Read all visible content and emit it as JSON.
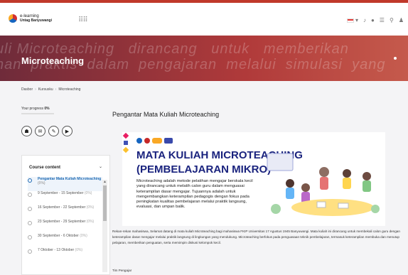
{
  "header": {
    "logo_line1": "e-learning",
    "logo_line2": "Untag Banyuwangi",
    "apps_icon": "grid-icon",
    "right_icons": [
      "flag-icon",
      "bell-icon",
      "chat-icon",
      "menu-icon",
      "search-icon",
      "user-icon"
    ]
  },
  "hero": {
    "title": "Microteaching",
    "bg_line1": "uli Microteaching   dirancang   untuk   memberikan",
    "bg_line2": "nan  praktis  dalam  pengajaran  melalui  simulasi  yang"
  },
  "breadcrumb": [
    "Dasbor",
    "Kursusku",
    "Microteaching"
  ],
  "progress": {
    "label": "Your progress",
    "value": "0%"
  },
  "activity_icons": [
    "quiz-icon",
    "forum-icon",
    "assign-icon",
    "resource-icon"
  ],
  "course_content": {
    "heading": "Course content",
    "items": [
      {
        "title": "Pengantar Mata Kuliah Microteaching",
        "pct": "(0%)",
        "active": true
      },
      {
        "title": "9 September - 15 September",
        "pct": "(0%)",
        "active": false
      },
      {
        "title": "16 September - 22 September",
        "pct": "(0%)",
        "active": false
      },
      {
        "title": "23 September - 29 September",
        "pct": "(0%)",
        "active": false
      },
      {
        "title": "30 September - 6 Oktober",
        "pct": "(0%)",
        "active": false
      },
      {
        "title": "7 Oktober - 13 Oktober",
        "pct": "(0%)",
        "active": false
      }
    ]
  },
  "main": {
    "title": "Pengantar Mata Kuliah Microteaching",
    "banner_title1": "MATA KULIAH MICROTEACHING",
    "banner_title2": "(PEMBELAJARAN MIKRO)",
    "banner_desc": "Microteaching adalah metode pelatihan mengajar berskala kecil yang dirancang untuk melatih calon guru dalam menguasai keterampilan dasar mengajar. Tujuannya adalah untuk mengembangkan keterampilan pedagogis dengan fokus pada peningkatan kualitas pembelajaran melalui praktik langsung, evaluasi, dan umpan balik.",
    "intro": "Rekan-rekan mahasiswa, Selamat datang di mata kuliah Microteaching bagi mahasiswa FKIP Universitas 17 Agustus 1945 Banyuwangi. Mata kuliah ini dirancang untuk membekali calon guru dengan keterampilan dasar mengajar melalui praktik langsung di lingkungan yang mendukung. Microteaching berfokus pada penguasaan teknik pembelajaran, termasuk keterampilan membuka dan menutup pelajaran, memberikan penguatan, serta memimpin diskusi kelompok kecil.",
    "sign": "Tim Pengajar"
  }
}
